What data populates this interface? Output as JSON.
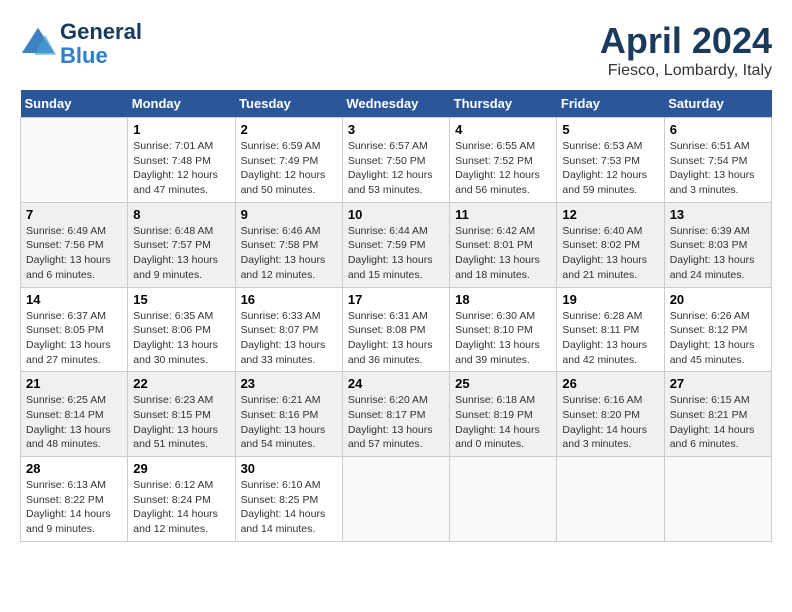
{
  "header": {
    "logo_text_general": "General",
    "logo_text_blue": "Blue",
    "month": "April 2024",
    "location": "Fiesco, Lombardy, Italy"
  },
  "days_of_week": [
    "Sunday",
    "Monday",
    "Tuesday",
    "Wednesday",
    "Thursday",
    "Friday",
    "Saturday"
  ],
  "weeks": [
    [
      {
        "day": "",
        "info": ""
      },
      {
        "day": "1",
        "info": "Sunrise: 7:01 AM\nSunset: 7:48 PM\nDaylight: 12 hours\nand 47 minutes."
      },
      {
        "day": "2",
        "info": "Sunrise: 6:59 AM\nSunset: 7:49 PM\nDaylight: 12 hours\nand 50 minutes."
      },
      {
        "day": "3",
        "info": "Sunrise: 6:57 AM\nSunset: 7:50 PM\nDaylight: 12 hours\nand 53 minutes."
      },
      {
        "day": "4",
        "info": "Sunrise: 6:55 AM\nSunset: 7:52 PM\nDaylight: 12 hours\nand 56 minutes."
      },
      {
        "day": "5",
        "info": "Sunrise: 6:53 AM\nSunset: 7:53 PM\nDaylight: 12 hours\nand 59 minutes."
      },
      {
        "day": "6",
        "info": "Sunrise: 6:51 AM\nSunset: 7:54 PM\nDaylight: 13 hours\nand 3 minutes."
      }
    ],
    [
      {
        "day": "7",
        "info": "Sunrise: 6:49 AM\nSunset: 7:56 PM\nDaylight: 13 hours\nand 6 minutes."
      },
      {
        "day": "8",
        "info": "Sunrise: 6:48 AM\nSunset: 7:57 PM\nDaylight: 13 hours\nand 9 minutes."
      },
      {
        "day": "9",
        "info": "Sunrise: 6:46 AM\nSunset: 7:58 PM\nDaylight: 13 hours\nand 12 minutes."
      },
      {
        "day": "10",
        "info": "Sunrise: 6:44 AM\nSunset: 7:59 PM\nDaylight: 13 hours\nand 15 minutes."
      },
      {
        "day": "11",
        "info": "Sunrise: 6:42 AM\nSunset: 8:01 PM\nDaylight: 13 hours\nand 18 minutes."
      },
      {
        "day": "12",
        "info": "Sunrise: 6:40 AM\nSunset: 8:02 PM\nDaylight: 13 hours\nand 21 minutes."
      },
      {
        "day": "13",
        "info": "Sunrise: 6:39 AM\nSunset: 8:03 PM\nDaylight: 13 hours\nand 24 minutes."
      }
    ],
    [
      {
        "day": "14",
        "info": "Sunrise: 6:37 AM\nSunset: 8:05 PM\nDaylight: 13 hours\nand 27 minutes."
      },
      {
        "day": "15",
        "info": "Sunrise: 6:35 AM\nSunset: 8:06 PM\nDaylight: 13 hours\nand 30 minutes."
      },
      {
        "day": "16",
        "info": "Sunrise: 6:33 AM\nSunset: 8:07 PM\nDaylight: 13 hours\nand 33 minutes."
      },
      {
        "day": "17",
        "info": "Sunrise: 6:31 AM\nSunset: 8:08 PM\nDaylight: 13 hours\nand 36 minutes."
      },
      {
        "day": "18",
        "info": "Sunrise: 6:30 AM\nSunset: 8:10 PM\nDaylight: 13 hours\nand 39 minutes."
      },
      {
        "day": "19",
        "info": "Sunrise: 6:28 AM\nSunset: 8:11 PM\nDaylight: 13 hours\nand 42 minutes."
      },
      {
        "day": "20",
        "info": "Sunrise: 6:26 AM\nSunset: 8:12 PM\nDaylight: 13 hours\nand 45 minutes."
      }
    ],
    [
      {
        "day": "21",
        "info": "Sunrise: 6:25 AM\nSunset: 8:14 PM\nDaylight: 13 hours\nand 48 minutes."
      },
      {
        "day": "22",
        "info": "Sunrise: 6:23 AM\nSunset: 8:15 PM\nDaylight: 13 hours\nand 51 minutes."
      },
      {
        "day": "23",
        "info": "Sunrise: 6:21 AM\nSunset: 8:16 PM\nDaylight: 13 hours\nand 54 minutes."
      },
      {
        "day": "24",
        "info": "Sunrise: 6:20 AM\nSunset: 8:17 PM\nDaylight: 13 hours\nand 57 minutes."
      },
      {
        "day": "25",
        "info": "Sunrise: 6:18 AM\nSunset: 8:19 PM\nDaylight: 14 hours\nand 0 minutes."
      },
      {
        "day": "26",
        "info": "Sunrise: 6:16 AM\nSunset: 8:20 PM\nDaylight: 14 hours\nand 3 minutes."
      },
      {
        "day": "27",
        "info": "Sunrise: 6:15 AM\nSunset: 8:21 PM\nDaylight: 14 hours\nand 6 minutes."
      }
    ],
    [
      {
        "day": "28",
        "info": "Sunrise: 6:13 AM\nSunset: 8:22 PM\nDaylight: 14 hours\nand 9 minutes."
      },
      {
        "day": "29",
        "info": "Sunrise: 6:12 AM\nSunset: 8:24 PM\nDaylight: 14 hours\nand 12 minutes."
      },
      {
        "day": "30",
        "info": "Sunrise: 6:10 AM\nSunset: 8:25 PM\nDaylight: 14 hours\nand 14 minutes."
      },
      {
        "day": "",
        "info": ""
      },
      {
        "day": "",
        "info": ""
      },
      {
        "day": "",
        "info": ""
      },
      {
        "day": "",
        "info": ""
      }
    ]
  ]
}
